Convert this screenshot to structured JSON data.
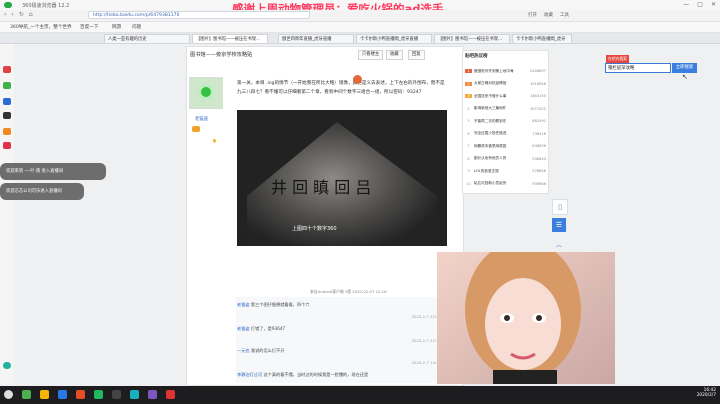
{
  "window": {
    "title": "360极速浏览器 12.2"
  },
  "overlay_text": "感谢上周动物管理员：爱吃火锅的ad选手",
  "address_bar": {
    "url": "http://tieba.baidu.com/p/6479381176"
  },
  "toolbar_right": [
    "打开",
    "收藏",
    "工具"
  ],
  "bookmarks": [
    "360导航_一个主页，整个世界",
    "百度一下",
    "网游",
    "问题"
  ],
  "tabs": [
    "人类一些有趣的历史",
    "【图片】图书馆——被压在书架...",
    "傲世四周年直播_虎牙直播",
    "卡卡尔斯小鸭直播間_虎牙直播",
    "【图片】图书馆——被压在书架...",
    "卡卡尔斯小鸭直播間_虎牙"
  ],
  "thread": {
    "title": "图书馆——旁京学校攻略贴",
    "buttons": [
      "只看楼主",
      "收藏",
      "回复"
    ],
    "author": "老猫盗",
    "post_text": "第一关，本目 .ing的情节（一开始我在所比大略）镜像，颜色是义去表述，上下左右的外围布，而不是九三八四七？看不懂可以仔细看第二个章，看到中间个数字三组合一组，所以密码：93247",
    "image_caption": "上图四十个数字360",
    "meta": "来自Android客户端 3楼 2020-02-07 22:16",
    "comments": [
      {
        "user": "老猫盗",
        "text": "第三个图仔细想就看看，四个六",
        "time": "2020-2-7 22:20"
      },
      {
        "user": "老猫盗",
        "text": "打错了，是93647",
        "time": "2020-2-7 22:22"
      },
      {
        "user": "一元也",
        "text": "我说的怎么打不开",
        "time": "2020-2-7 14:37"
      },
      {
        "user": "李静泊打过河",
        "text": "这个真的看不懂，当时过的时候我是一脸懵的，现在还是",
        "time": ""
      }
    ],
    "join_label": "我要回复"
  },
  "hot_list": {
    "title": "贴吧热议榜",
    "items": [
      {
        "rank": "1",
        "label": "傲慢机舟开到第上地中海",
        "count": "2248697"
      },
      {
        "rank": "2",
        "label": "大家正确对抗疫情指",
        "count": "1918658"
      },
      {
        "rank": "3",
        "label": "全国送来不做什么事",
        "count": "1483150"
      },
      {
        "rank": "4",
        "label": "影响新冠大三篇地矿",
        "count": "1071522"
      },
      {
        "rank": "5",
        "label": "不能再二次的看到东",
        "count": "882491"
      },
      {
        "rank": "6",
        "label": "完全应国少投任候选",
        "count": "736418"
      },
      {
        "rank": "7",
        "label": "网暴资本被禁用原因",
        "count": "646836"
      },
      {
        "rank": "8",
        "label": "副长认危有他员人的",
        "count": "546644"
      },
      {
        "rank": "9",
        "label": "LOL的英语正规",
        "count": "576846"
      },
      {
        "rank": "10",
        "label": "粘达可回新小意赵的",
        "count": "939866"
      }
    ]
  },
  "search": {
    "value": "猪栏层深攻略",
    "button": "立即搜索",
    "hint": "在吧内搜索"
  },
  "chat_bubbles": [
    {
      "text": "欢迎来到 一·叶·落 进入直播间"
    },
    {
      "text": "欢迎芯芯公司可乐进入直播间"
    }
  ],
  "taskbar": {
    "time": "16:42",
    "date": "2020/2/7"
  },
  "colors": {
    "accent_blue": "#3a7fe0",
    "overlay_pink": "#ff3b60",
    "hot_rank": "#e8603c"
  }
}
